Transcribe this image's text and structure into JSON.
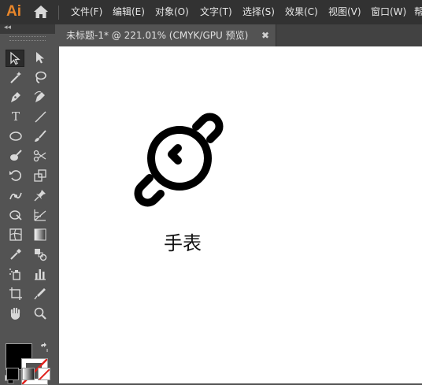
{
  "app": {
    "logo": "Ai"
  },
  "menu": [
    "文件(F)",
    "编辑(E)",
    "对象(O)",
    "文字(T)",
    "选择(S)",
    "效果(C)",
    "视图(V)",
    "窗口(W)",
    "帮"
  ],
  "document": {
    "tab_title": "未标题-1* @ 221.01% (CMYK/GPU 预览)",
    "close_glyph": "✖"
  },
  "toolbar": {
    "collapse_glyph": "◂◂",
    "type_tool": "T"
  },
  "artwork": {
    "caption": "手表"
  },
  "colors": {
    "fill": "#000000",
    "stroke": "none",
    "accent": "#e8862a"
  },
  "icons": [
    "selection-icon",
    "direct-selection-icon",
    "magic-wand-icon",
    "lasso-icon",
    "pen-icon",
    "curvature-icon",
    "type-icon",
    "line-icon",
    "ellipse-icon",
    "paintbrush-icon",
    "blob-brush-icon",
    "scissors-icon",
    "rotate-icon",
    "scale-icon",
    "puppet-warp-icon",
    "pin-icon",
    "shape-builder-icon",
    "perspective-grid-icon",
    "mesh-icon",
    "gradient-icon",
    "eyedropper-icon",
    "blend-icon",
    "symbol-sprayer-icon",
    "column-graph-icon",
    "artboard-icon",
    "slice-icon",
    "hand-icon",
    "zoom-icon"
  ]
}
